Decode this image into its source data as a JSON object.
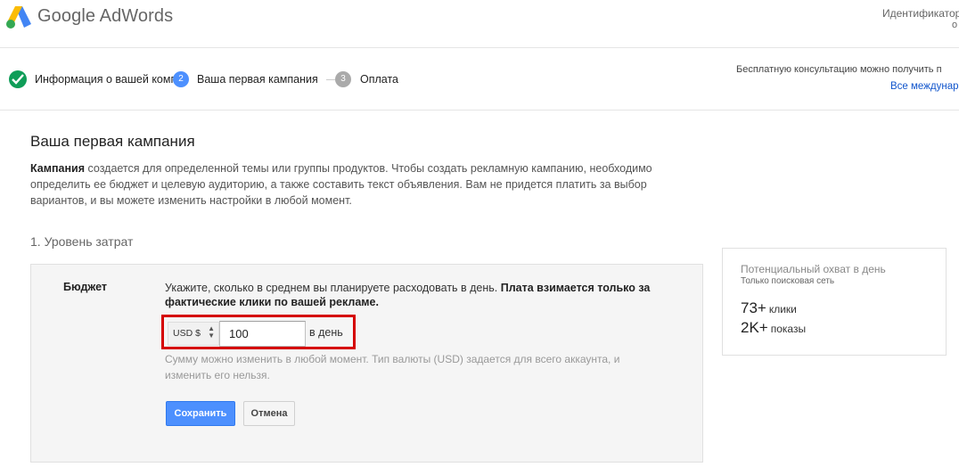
{
  "header": {
    "brand": "Google AdWords",
    "account_id_label": "Идентификатор",
    "account_id_sub": "о"
  },
  "steps": {
    "items": [
      {
        "number": "",
        "label": "Информация о вашей компании",
        "status": "done"
      },
      {
        "number": "2",
        "label": "Ваша первая кампания",
        "status": "active"
      },
      {
        "number": "3",
        "label": "Оплата",
        "status": "pending"
      }
    ],
    "consult_text": "Бесплатную консультацию можно получить п",
    "intl_link": "Все междунар"
  },
  "main": {
    "title": "Ваша первая кампания",
    "intro_bold": "Кампания",
    "intro_text": " создается для определенной темы или группы продуктов. Чтобы создать рекламную кампанию, необходимо определить ее бюджет и целевую аудиторию, а также составить текст объявления. Вам не придется платить за выбор вариантов, и вы можете изменить настройки в любой момент.",
    "section_title": "1. Уровень затрат"
  },
  "budget": {
    "label": "Бюджет",
    "desc_text": "Укажите, сколько в среднем вы планируете расходовать в день. ",
    "desc_bold": "Плата взимается только за фактические клики по вашей рекламе.",
    "currency": "USD $",
    "amount": "100",
    "per_day": "в день",
    "hint": "Сумму можно изменить в любой момент. Тип валюты (USD) задается для всего аккаунта, и изменить его нельзя.",
    "save_label": "Сохранить",
    "cancel_label": "Отмена"
  },
  "reach": {
    "title": "Потенциальный охват в день",
    "subtitle": "Только поисковая сеть",
    "clicks_value": "73+",
    "clicks_unit": "клики",
    "impressions_value": "2K+",
    "impressions_unit": "показы"
  },
  "colors": {
    "accent": "#4d90fe",
    "success": "#0f9d58",
    "highlight": "#d50000",
    "link": "#1155cc"
  }
}
